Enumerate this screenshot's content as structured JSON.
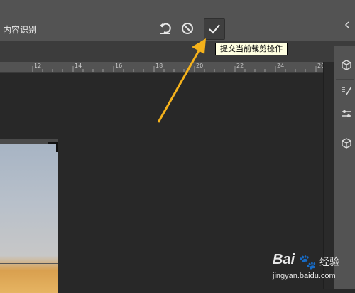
{
  "options_bar": {
    "content_aware_label": "内容识别",
    "undo_icon": "reset-icon",
    "cancel_icon": "cancel-icon",
    "commit_icon": "checkmark-icon"
  },
  "tooltip": {
    "text": "提交当前裁剪操作"
  },
  "ruler": {
    "ticks": [
      "12",
      "14",
      "16",
      "18",
      "20",
      "22",
      "24",
      "26"
    ]
  },
  "watermark": {
    "brand": "Bai",
    "paw": "🐾",
    "suffix": "经验",
    "url": "jingyan.baidu.com"
  },
  "colors": {
    "ui_panel": "#535353",
    "canvas_bg": "#282828",
    "tooltip_bg": "#ffffe1",
    "annotation_arrow": "#f5b21b"
  }
}
